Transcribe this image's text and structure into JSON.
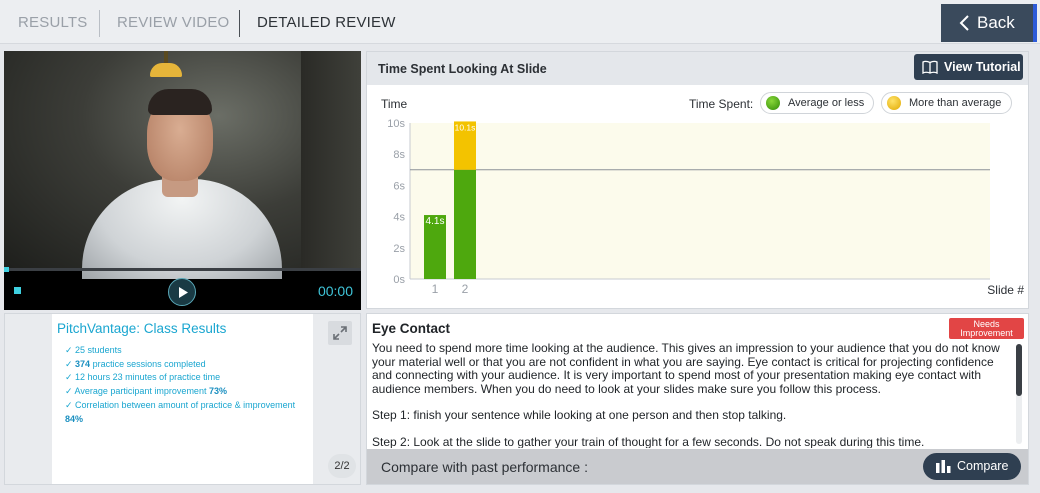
{
  "tabs": [
    {
      "label": "RESULTS"
    },
    {
      "label": "REVIEW VIDEO"
    },
    {
      "label": "DETAILED REVIEW"
    }
  ],
  "back_button": {
    "label": "Back"
  },
  "video": {
    "time": "00:00"
  },
  "chart_panel": {
    "title": "Time Spent Looking At Slide",
    "tutorial_label": "View Tutorial",
    "time_spent_label": "Time Spent:",
    "legend": [
      {
        "label": "Average or less",
        "color": "#3fa010"
      },
      {
        "label": "More than average",
        "color": "#f2c200"
      }
    ]
  },
  "chart_data": {
    "type": "bar",
    "ylabel": "Time",
    "xlabel": "Slide #",
    "ylim": [
      0,
      10
    ],
    "yticks": [
      "0s",
      "2s",
      "4s",
      "6s",
      "8s",
      "10s"
    ],
    "categories": [
      "1",
      "2"
    ],
    "values": [
      4.1,
      10.1
    ],
    "value_labels": [
      "4.1s",
      "10.1s"
    ],
    "average_line": 7,
    "colors": {
      "below": "#4ea80e",
      "above": "#f3c300"
    }
  },
  "slide": {
    "title": "PitchVantage: Class Results",
    "items": [
      {
        "pre": "✓ 25 students",
        "bold": "",
        "post": ""
      },
      {
        "pre": "✓ ",
        "bold": "374",
        "post": " practice sessions completed"
      },
      {
        "pre": "✓ 12 hours 23 minutes of practice time",
        "bold": "",
        "post": ""
      },
      {
        "pre": "✓ Average participant improvement ",
        "bold": "73%",
        "post": ""
      },
      {
        "pre": "✓ Correlation between amount of practice & improvement",
        "bold": "",
        "post": ""
      },
      {
        "pre": "",
        "bold": "84%",
        "post": ""
      }
    ],
    "page": "2/2"
  },
  "feedback": {
    "title": "Eye Contact",
    "badge_line1": "Needs",
    "badge_line2": "Improvement",
    "paragraph1": "You need to spend more time looking at the audience. This gives an impression to your audience that you do not know your material well or that you are not confident in what you are saying.  Eye contact is critical for projecting confidence and connecting with your audience. It is very important to spend most of your presentation making eye contact with audience members. When you do need to look at your slides make sure you follow this process.",
    "paragraph2": "Step 1: finish your sentence while looking at one person and then stop talking.",
    "paragraph3": "Step 2: Look at the slide to gather your train of thought for a few seconds. Do not speak during this time.",
    "compare_label": "Compare with past performance :",
    "compare_button": "Compare"
  }
}
